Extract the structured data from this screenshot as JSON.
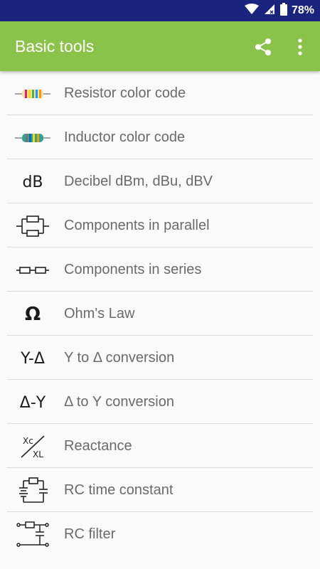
{
  "status_bar": {
    "battery_text": "78%"
  },
  "app_bar": {
    "title": "Basic tools",
    "actions": [
      "share-icon",
      "more-vert-icon"
    ]
  },
  "tools": [
    {
      "label": "Resistor color code",
      "icon": "resistor-icon"
    },
    {
      "label": "Inductor color code",
      "icon": "inductor-icon"
    },
    {
      "label": "Decibel dBm, dBu, dBV",
      "icon": "decibel-icon",
      "icon_text": "dB"
    },
    {
      "label": "Components in parallel",
      "icon": "parallel-icon"
    },
    {
      "label": "Components in series",
      "icon": "series-icon"
    },
    {
      "label": "Ohm's Law",
      "icon": "ohm-icon",
      "icon_text": "Ω"
    },
    {
      "label": "Y to Δ conversion",
      "icon": "y-delta-icon",
      "icon_text": "Y-Δ"
    },
    {
      "label": "Δ to Y conversion",
      "icon": "delta-y-icon",
      "icon_text": "Δ-Y"
    },
    {
      "label": "Reactance",
      "icon": "reactance-icon",
      "icon_text_top": "Xc",
      "icon_text_bottom": "XL"
    },
    {
      "label": "RC time constant",
      "icon": "rc-time-constant-icon"
    },
    {
      "label": "RC filter",
      "icon": "rc-filter-icon"
    }
  ],
  "colors": {
    "status_bar": "#1a237e",
    "app_bar": "#8bc34a",
    "background": "#fafafa",
    "label_text": "#6a6a6a"
  }
}
